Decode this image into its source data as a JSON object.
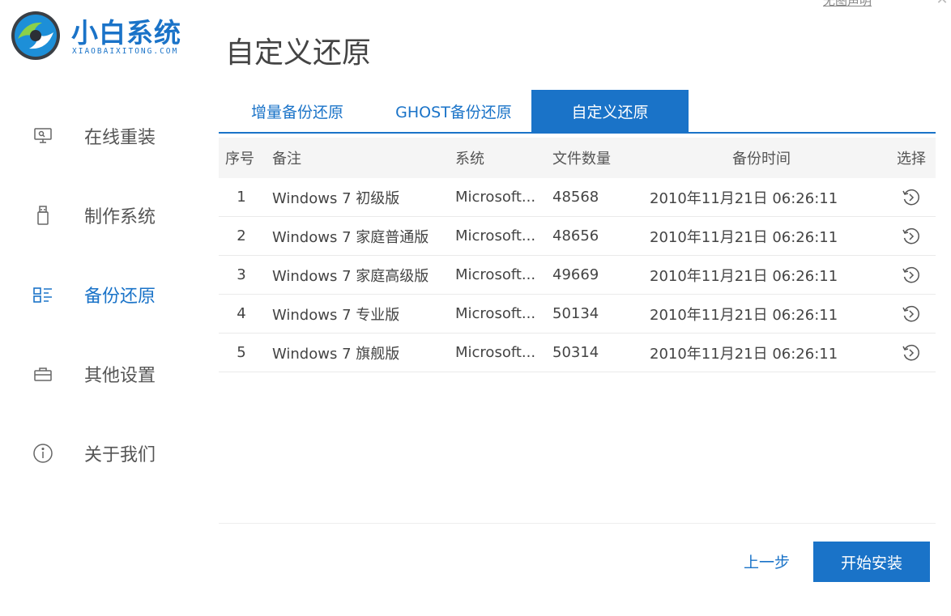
{
  "brand": {
    "name": "小白系统",
    "subtitle": "XIAOBAIXITONG.COM"
  },
  "top_link": "无图声明",
  "page_title": "自定义还原",
  "sidebar": {
    "items": [
      {
        "label": "在线重装",
        "icon": "monitor-icon"
      },
      {
        "label": "制作系统",
        "icon": "usb-icon"
      },
      {
        "label": "备份还原",
        "icon": "backup-icon",
        "active": true
      },
      {
        "label": "其他设置",
        "icon": "briefcase-icon"
      },
      {
        "label": "关于我们",
        "icon": "info-icon"
      }
    ]
  },
  "tabs": [
    {
      "label": "增量备份还原"
    },
    {
      "label": "GHOST备份还原"
    },
    {
      "label": "自定义还原",
      "active": true
    }
  ],
  "table": {
    "headers": {
      "index": "序号",
      "note": "备注",
      "system": "系统",
      "count": "文件数量",
      "time": "备份时间",
      "select": "选择"
    },
    "rows": [
      {
        "index": "1",
        "note": "Windows 7 初级版",
        "system": "Microsoft...",
        "count": "48568",
        "time": "2010年11月21日 06:26:11"
      },
      {
        "index": "2",
        "note": "Windows 7 家庭普通版",
        "system": "Microsoft...",
        "count": "48656",
        "time": "2010年11月21日 06:26:11"
      },
      {
        "index": "3",
        "note": "Windows 7 家庭高级版",
        "system": "Microsoft...",
        "count": "49669",
        "time": "2010年11月21日 06:26:11"
      },
      {
        "index": "4",
        "note": "Windows 7 专业版",
        "system": "Microsoft...",
        "count": "50134",
        "time": "2010年11月21日 06:26:11"
      },
      {
        "index": "5",
        "note": "Windows 7 旗舰版",
        "system": "Microsoft...",
        "count": "50314",
        "time": "2010年11月21日 06:26:11"
      }
    ]
  },
  "buttons": {
    "prev": "上一步",
    "start": "开始安装"
  },
  "colors": {
    "accent": "#1a73c8",
    "header_bg": "#f5f5f5",
    "text": "#444444"
  }
}
